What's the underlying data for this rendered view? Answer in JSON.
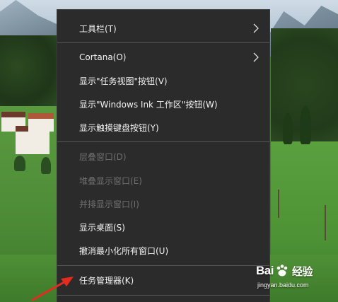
{
  "menu": {
    "items": [
      {
        "label": "工具栏(T)",
        "has_submenu": true,
        "disabled": false
      },
      {
        "label": "Cortana(O)",
        "has_submenu": true,
        "disabled": false
      },
      {
        "label": "显示\"任务视图\"按钮(V)",
        "has_submenu": false,
        "disabled": false
      },
      {
        "label": "显示\"Windows Ink 工作区\"按钮(W)",
        "has_submenu": false,
        "disabled": false
      },
      {
        "label": "显示触摸键盘按钮(Y)",
        "has_submenu": false,
        "disabled": false
      },
      {
        "label": "层叠窗口(D)",
        "has_submenu": false,
        "disabled": true
      },
      {
        "label": "堆叠显示窗口(E)",
        "has_submenu": false,
        "disabled": true
      },
      {
        "label": "并排显示窗口(I)",
        "has_submenu": false,
        "disabled": true
      },
      {
        "label": "显示桌面(S)",
        "has_submenu": false,
        "disabled": false
      },
      {
        "label": "撤消最小化所有窗口(U)",
        "has_submenu": false,
        "disabled": false
      },
      {
        "label": "任务管理器(K)",
        "has_submenu": false,
        "disabled": false
      }
    ]
  },
  "watermark": {
    "brand_left": "Bai",
    "brand_right": "经验",
    "url": "jingyan.baidu.com"
  },
  "colors": {
    "menu_bg": "#2b2b2b",
    "menu_text": "#f2f2f2",
    "menu_disabled": "#6f6f6f",
    "separator": "#555555",
    "annotation_arrow": "#e52b1e"
  }
}
